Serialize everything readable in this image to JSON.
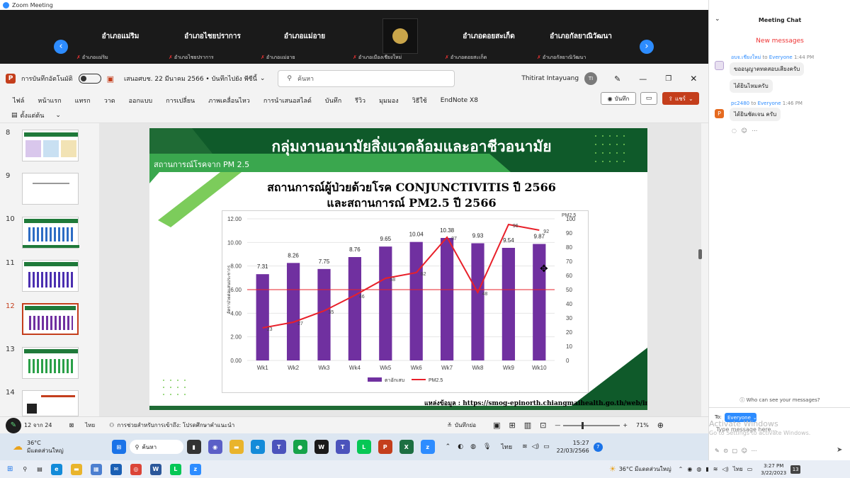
{
  "zoom": {
    "window_title": "Zoom Meeting",
    "tiles": [
      {
        "name": "อำเภอแม่ริม",
        "sub": "อำเภอแม่ริม"
      },
      {
        "name": "อำเภอไชยปราการ",
        "sub": "อำเภอไชยปราการ"
      },
      {
        "name": "อำเภอแม่อาย",
        "sub": "อำเภอแม่อาย"
      },
      {
        "name": "",
        "sub": "อำเภอเมืองเชียงใหม่"
      },
      {
        "name": "อำเภอดอยสะเก็ด",
        "sub": "อำเภอดอยสะเก็ด"
      },
      {
        "name": "อำเภอกัลยาณิวัฒนา",
        "sub": "อำเภอกัลยาณิวัฒนา"
      }
    ]
  },
  "ppt": {
    "autosave_label": "การบันทึกอัตโนมัติ",
    "doc_title": "เสนอศบช. 22 มีนาคม 2566 • บันทึกไปยัง พีซีนี้",
    "search_placeholder": "ค้นหา",
    "user_name": "Thitirat Intayuang",
    "user_initials": "TI",
    "tabs": [
      "ไฟล์",
      "หน้าแรก",
      "แทรก",
      "วาด",
      "ออกแบบ",
      "การเปลี่ยน",
      "ภาพเคลื่อนไหว",
      "การนำเสนอสไลด์",
      "บันทึก",
      "รีวิว",
      "มุมมอง",
      "วิธีใช้",
      "EndNote X8"
    ],
    "record_label": "บันทึก",
    "share_label": "แชร์",
    "from_start_label": "ตั้งแต่ต้น",
    "slide_numbers": [
      "8",
      "9",
      "10",
      "11",
      "12",
      "13",
      "14"
    ],
    "status_left": "12 จาก 24",
    "status_lang": "ไทย",
    "status_access": "การช่วยสำหรับการเข้าถึง: โปรดศึกษาคำแนะนำ",
    "notes_label": "บันทึกย่อ",
    "zoom_pct": "71%"
  },
  "slide": {
    "header_title": "กลุ่มงานอนามัยสิ่งแวดล้อมและอาชีวอนามัย",
    "banner_text": "สถานการณ์โรคจาก PM 2.5",
    "chart_title_1": "สถานการณ์ผู้ป่วยด้วยโรค CONJUNCTIVITIS ปี 2566",
    "chart_title_2": "และสถานการณ์ PM2.5 ปี 2566",
    "source_text": "แหล่งข้อมูล : https://smog-epinorth.chiangmaihealth.go.th/web/index.php"
  },
  "chart_data": {
    "type": "bar",
    "categories": [
      "Wk1",
      "Wk2",
      "Wk3",
      "Wk4",
      "Wk5",
      "Wk6",
      "Wk7",
      "Wk8",
      "Wk9",
      "Wk10"
    ],
    "series": [
      {
        "name": "ตาอักเสบ",
        "type": "bar",
        "axis": "left",
        "color": "#7030a0",
        "values": [
          7.31,
          8.26,
          7.75,
          8.76,
          9.65,
          10.04,
          10.38,
          9.93,
          9.54,
          9.87
        ]
      },
      {
        "name": "PM2.5",
        "type": "line",
        "axis": "right",
        "color": "#e8202a",
        "values": [
          23,
          27,
          35,
          46,
          58,
          62,
          87,
          48,
          96,
          92
        ]
      }
    ],
    "ylabel": "อัตราป่วยต่อแสนประชากร",
    "y2label": "PM2.5",
    "ylim": [
      0,
      12
    ],
    "y_ticks": [
      "0.00",
      "2.00",
      "4.00",
      "6.00",
      "8.00",
      "10.00",
      "12.00"
    ],
    "y2lim": [
      0,
      100
    ],
    "y2_ticks": [
      "0",
      "10",
      "20",
      "30",
      "40",
      "50",
      "60",
      "70",
      "80",
      "90",
      "100"
    ],
    "threshold_right": 50,
    "threshold_color": "#e8202a",
    "legend_position": "bottom"
  },
  "chat": {
    "title": "Meeting Chat",
    "new_messages": "New messages",
    "messages": [
      {
        "sender": "อบจ.เชียงใหม่",
        "to": "to",
        "recipient": "Everyone",
        "time": "1:44 PM",
        "lines": [
          "ขออนุญาตทดสอบเสียงครับ",
          "ได้ยินไหมครับ"
        ]
      },
      {
        "sender": "pc2480",
        "to": "to",
        "recipient": "Everyone",
        "time": "1:46 PM",
        "lines": [
          "ได้ยินชัดเจน ครับ"
        ]
      }
    ],
    "who_can_see": "Who can see your messages?",
    "to_label": "To:",
    "to_value": "Everyone",
    "input_placeholder": "Type message here...",
    "activate_line1": "Activate Windows",
    "activate_line2": "Go to Settings to activate Windows."
  },
  "taskbar_inner": {
    "weather_temp": "36°C",
    "weather_desc": "มีแดดส่วนใหญ่",
    "search": "ค้นหา",
    "lang": "ไทย",
    "time": "15:27",
    "date": "22/03/2566",
    "badge": "7"
  },
  "taskbar_outer": {
    "weather": "36°C มีแดดส่วนใหญ่",
    "lang": "ไทย",
    "time": "3:27 PM",
    "date": "3/22/2023",
    "badge": "13"
  }
}
